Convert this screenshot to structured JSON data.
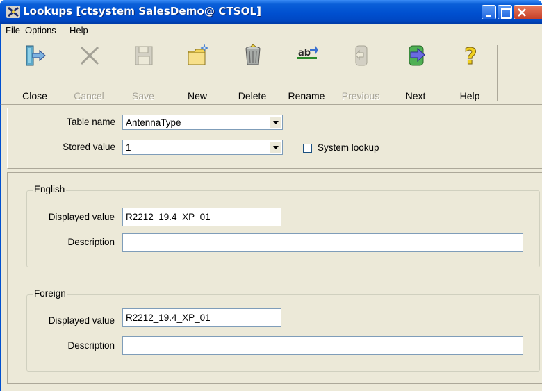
{
  "window": {
    "title": "Lookups [ctsystem SalesDemo@ CTSOL]"
  },
  "menu": [
    {
      "label": "File"
    },
    {
      "label": "Options"
    },
    {
      "label": "Help"
    }
  ],
  "toolbar": {
    "close": "Close",
    "cancel": "Cancel",
    "save": "Save",
    "new": "New",
    "delete": "Delete",
    "rename": "Rename",
    "previous": "Previous",
    "next": "Next",
    "help": "Help"
  },
  "lookup": {
    "table_name_label": "Table name",
    "table_name_value": "AntennaType",
    "stored_value_label": "Stored value",
    "stored_value_value": "1",
    "system_lookup_label": "System lookup"
  },
  "english": {
    "legend": "English",
    "displayed_label": "Displayed value",
    "displayed_value": "R2212_19.4_XP_01",
    "description_label": "Description",
    "description_value": ""
  },
  "foreign": {
    "legend": "Foreign",
    "displayed_label": "Displayed value",
    "displayed_value": "R2212_19.4_XP_01",
    "description_label": "Description",
    "description_value": ""
  }
}
